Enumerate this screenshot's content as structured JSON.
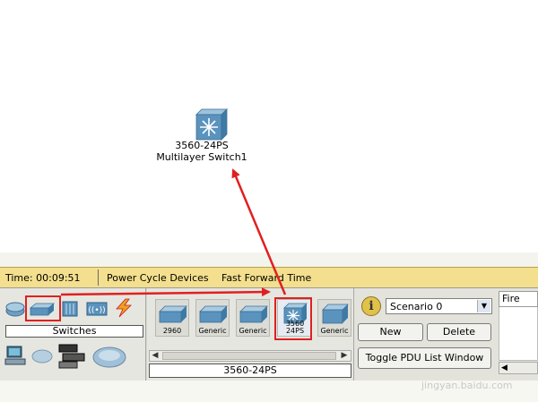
{
  "workspace": {
    "device_name": "3560-24PS",
    "device_type": "Multilayer Switch1"
  },
  "status_bar": {
    "time_label": "Time: 00:09:51",
    "power_cycle_label": "Power Cycle Devices",
    "fast_forward_label": "Fast Forward Time"
  },
  "device_category": {
    "selected_label": "Switches"
  },
  "device_list": {
    "items": [
      {
        "label": "2960"
      },
      {
        "label": "Generic"
      },
      {
        "label": "Generic"
      },
      {
        "label": "3560 24PS"
      },
      {
        "label": "Generic"
      }
    ],
    "selected_name": "3560-24PS"
  },
  "pdu": {
    "info_glyph": "i",
    "scenario_value": "Scenario 0",
    "new_label": "New",
    "delete_label": "Delete",
    "toggle_label": "Toggle PDU List Window"
  },
  "fire_column": {
    "header": "Fire"
  },
  "watermark": "jingyan.baidu.com",
  "colors": {
    "status_bar": "#f3df8d",
    "highlight": "#e02020",
    "switch_blue": "#5a93bd"
  }
}
